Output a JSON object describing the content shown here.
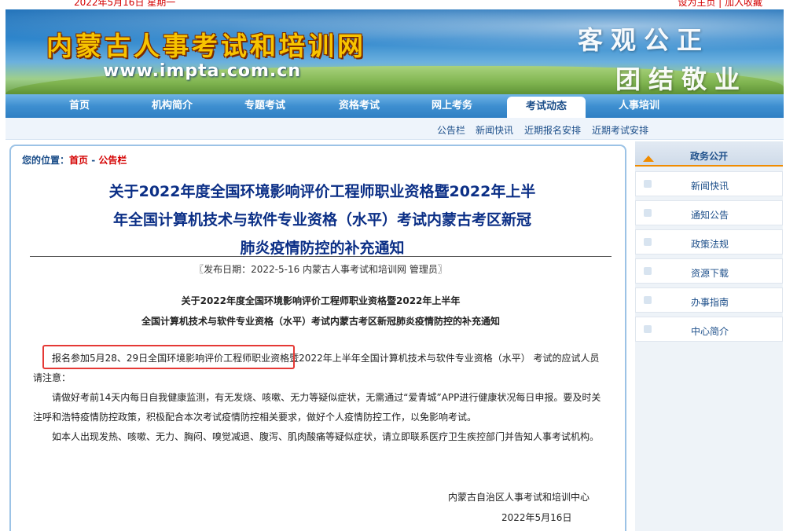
{
  "topstrip": {
    "left_text": "2022年5月16日 星期一",
    "right_text": "设为主页 | 加入收藏"
  },
  "banner": {
    "site_title": "内蒙古人事考试和培训网",
    "site_url": "www.impta.com.cn",
    "slogan_line1": "客观公正",
    "slogan_line2": "团结敬业"
  },
  "nav": {
    "items": [
      "首页",
      "机构简介",
      "专题考试",
      "资格考试",
      "网上考务",
      "考试动态",
      "人事培训"
    ],
    "active": "考试动态"
  },
  "subnav": {
    "items": [
      "公告栏",
      "新闻快讯",
      "近期报名安排",
      "近期考试安排"
    ]
  },
  "breadcrumb": {
    "prefix": "您的位置：",
    "home": "首页",
    "sep": " - ",
    "current": "公告栏"
  },
  "article": {
    "title_lines": [
      "关于2022年度全国环境影响评价工程师职业资格暨2022年上半",
      "年全国计算机技术与软件专业资格（水平）考试内蒙古考区新冠",
      "肺炎疫情防控的补充通知"
    ],
    "meta": "〖发布日期：2022-5-16 内蒙古人事考试和培训网 管理员〗",
    "subtitle_line1": "关于2022年度全国环境影响评价工程师职业资格暨2022年上半年",
    "subtitle_line2": "全国计算机技术与软件专业资格（水平）考试内蒙古考区新冠肺炎疫情防控的补充通知",
    "p1": "报名参加5月28、29日全国环境影响评价工程师职业资格暨2022年上半年全国计算机技术与软件专业资格（水平） 考试的应试人员请注意：",
    "p2": "请做好考前14天内每日自我健康监测，有无发烧、咳嗽、无力等疑似症状，无需通过“爱青城”APP进行健康状况每日申报。要及时关注呼和浩特疫情防控政策，积极配合本次考试疫情防控相关要求，做好个人疫情防控工作，以免影响考试。",
    "p3": "如本人出现发热、咳嗽、无力、胸闷、嗅觉减退、腹泻、肌肉酸痛等疑似症状，请立即联系医疗卫生疾控部门并告知人事考试机构。",
    "sign_org": "内蒙古自治区人事考试和培训中心",
    "sign_date": "2022年5月16日"
  },
  "sidebar": {
    "header": "政务公开",
    "items": [
      "新闻快讯",
      "通知公告",
      "政策法规",
      "资源下载",
      "办事指南",
      "中心简介"
    ]
  },
  "colors": {
    "accent": "#e53935",
    "nav_blue": "#3e8fd0",
    "title_blue": "#0b2f86",
    "sidebar_orange": "#f08c00"
  }
}
